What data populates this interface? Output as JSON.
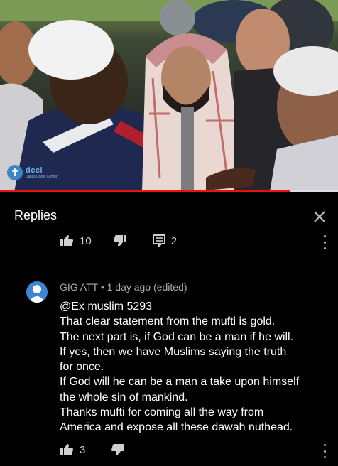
{
  "video": {
    "channel_logo_text": "dcci",
    "channel_logo_sub": "Dallas Christ Center",
    "progress": 0.86,
    "accent_color": "#ee1111"
  },
  "replies_panel": {
    "title": "Replies",
    "close_icon": "close-icon"
  },
  "parent_actions": {
    "like_count": "10",
    "reply_count": "2"
  },
  "comment": {
    "author": "GIG ATT",
    "separator": "•",
    "time": "1 day ago (edited)",
    "lines": [
      "@Ex muslim 5293",
      "That clear statement from the mufti is gold.",
      "The next part is, if God can be a man if he will.",
      "If yes, then we have Muslims saying the truth",
      "for once.",
      "If God will he can be a man a take upon himself",
      "the whole sin of mankind.",
      "Thanks mufti for coming all the way from",
      "America and expose all these dawah nuthead."
    ],
    "like_count": "3",
    "avatar_color": "#3f85d6"
  }
}
